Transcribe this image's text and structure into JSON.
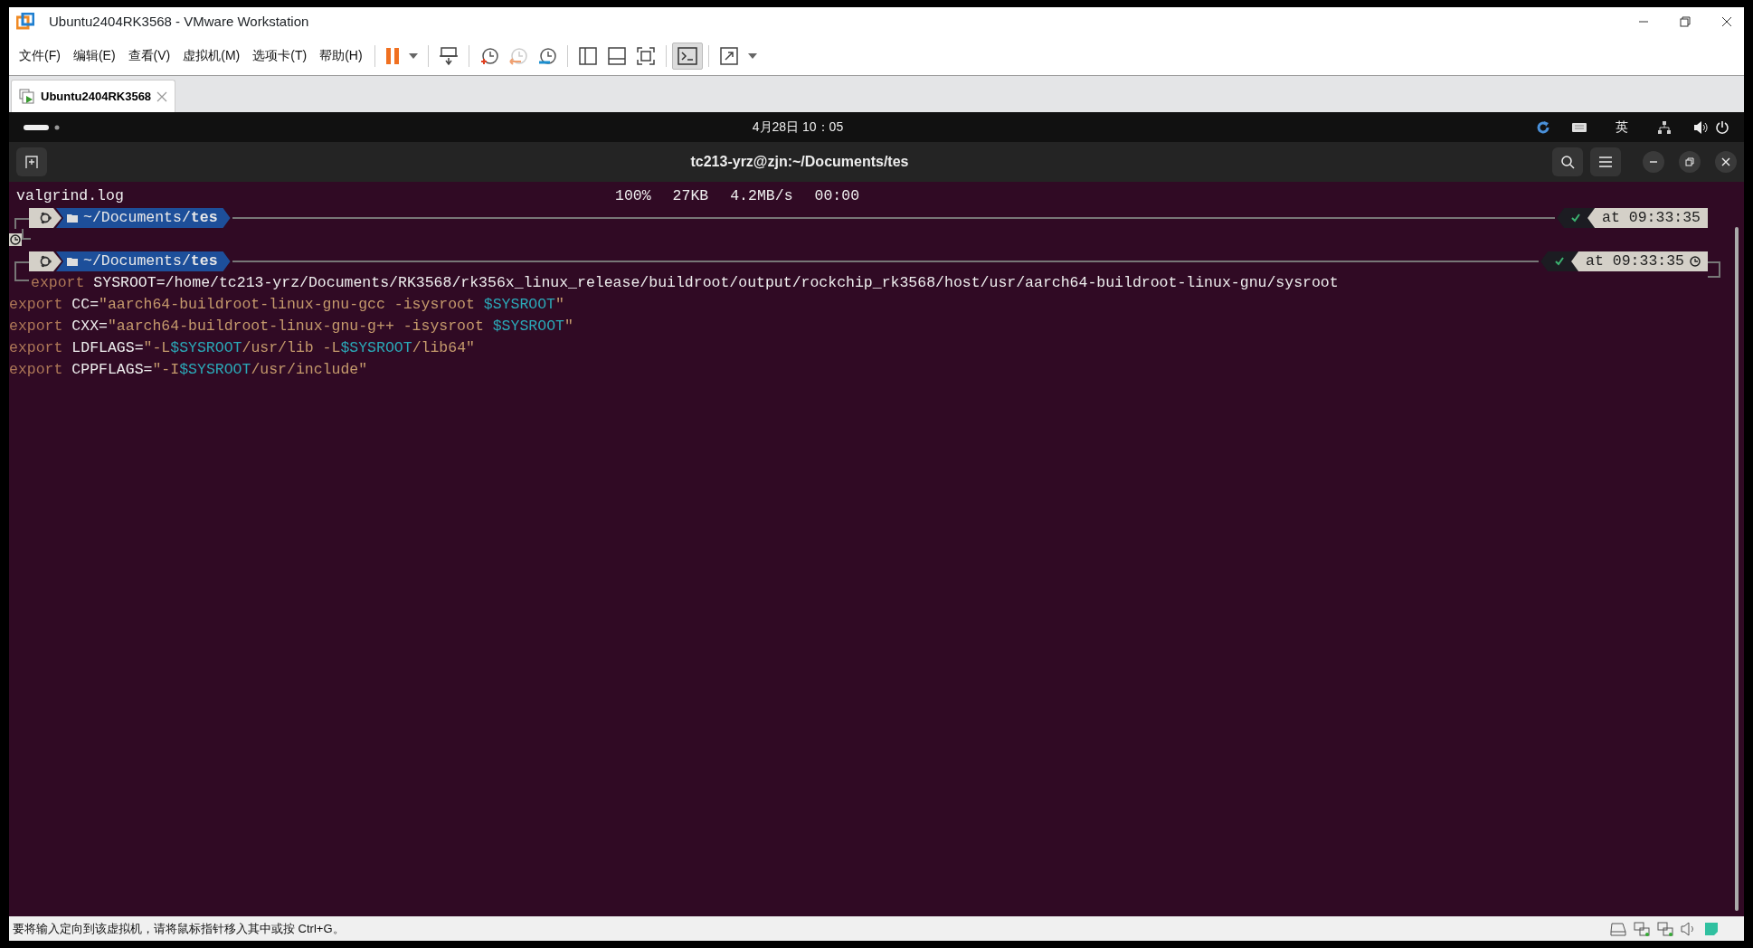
{
  "window": {
    "title": "Ubuntu2404RK3568 - VMware Workstation"
  },
  "menu": [
    "文件(F)",
    "编辑(E)",
    "查看(V)",
    "虚拟机(M)",
    "选项卡(T)",
    "帮助(H)"
  ],
  "tabs": [
    {
      "label": "Ubuntu2404RK3568",
      "selected": true
    }
  ],
  "guest_top_bar": {
    "clock": "4月28日 10：05",
    "input_method": "英"
  },
  "terminal": {
    "title": "tc213-yrz@zjn:~/Documents/tes",
    "transfer": {
      "file": "valgrind.log",
      "percent": "100%",
      "size": "27KB",
      "speed": "4.2MB/s",
      "eta": "00:00"
    },
    "prompts": [
      {
        "path": "~/Documents/",
        "dir": "tes",
        "ok": true,
        "time": "at 09:33:35",
        "clock": false
      },
      {
        "path": "~/Documents/",
        "dir": "tes",
        "ok": true,
        "time": "at 09:33:35",
        "clock": true
      }
    ],
    "lines": [
      [
        {
          "text": "export",
          "kind": "keyword"
        },
        {
          "text": " SYSROOT=/home/tc213-yrz/Documents/RK3568/rk356x_linux_release/buildroot/output/rockchip_rk3568/host/usr/aarch64-buildroot-linux-gnu/sysroot",
          "kind": "plain"
        }
      ],
      [
        {
          "text": "export",
          "kind": "keyword"
        },
        {
          "text": " CC=",
          "kind": "plain"
        },
        {
          "text": "\"aarch64-buildroot-linux-gnu-gcc -isysroot ",
          "kind": "string"
        },
        {
          "text": "$SYSROOT",
          "kind": "variable"
        },
        {
          "text": "\"",
          "kind": "string"
        }
      ],
      [
        {
          "text": "export",
          "kind": "keyword"
        },
        {
          "text": " CXX=",
          "kind": "plain"
        },
        {
          "text": "\"aarch64-buildroot-linux-gnu-g++ -isysroot ",
          "kind": "string"
        },
        {
          "text": "$SYSROOT",
          "kind": "variable"
        },
        {
          "text": "\"",
          "kind": "string"
        }
      ],
      [
        {
          "text": "export",
          "kind": "keyword"
        },
        {
          "text": " LDFLAGS=",
          "kind": "plain"
        },
        {
          "text": "\"-L",
          "kind": "string"
        },
        {
          "text": "$SYSROOT",
          "kind": "variable"
        },
        {
          "text": "/usr/lib -L",
          "kind": "string"
        },
        {
          "text": "$SYSROOT",
          "kind": "variable"
        },
        {
          "text": "/lib64\"",
          "kind": "string"
        }
      ],
      [
        {
          "text": "export",
          "kind": "keyword"
        },
        {
          "text": " CPPFLAGS=",
          "kind": "plain"
        },
        {
          "text": "\"-I",
          "kind": "string"
        },
        {
          "text": "$SYSROOT",
          "kind": "variable"
        },
        {
          "text": "/usr/include\"",
          "kind": "string"
        }
      ]
    ]
  },
  "status_bar": {
    "message": "要将输入定向到该虚拟机，请将鼠标指针移入其中或按 Ctrl+G。"
  }
}
